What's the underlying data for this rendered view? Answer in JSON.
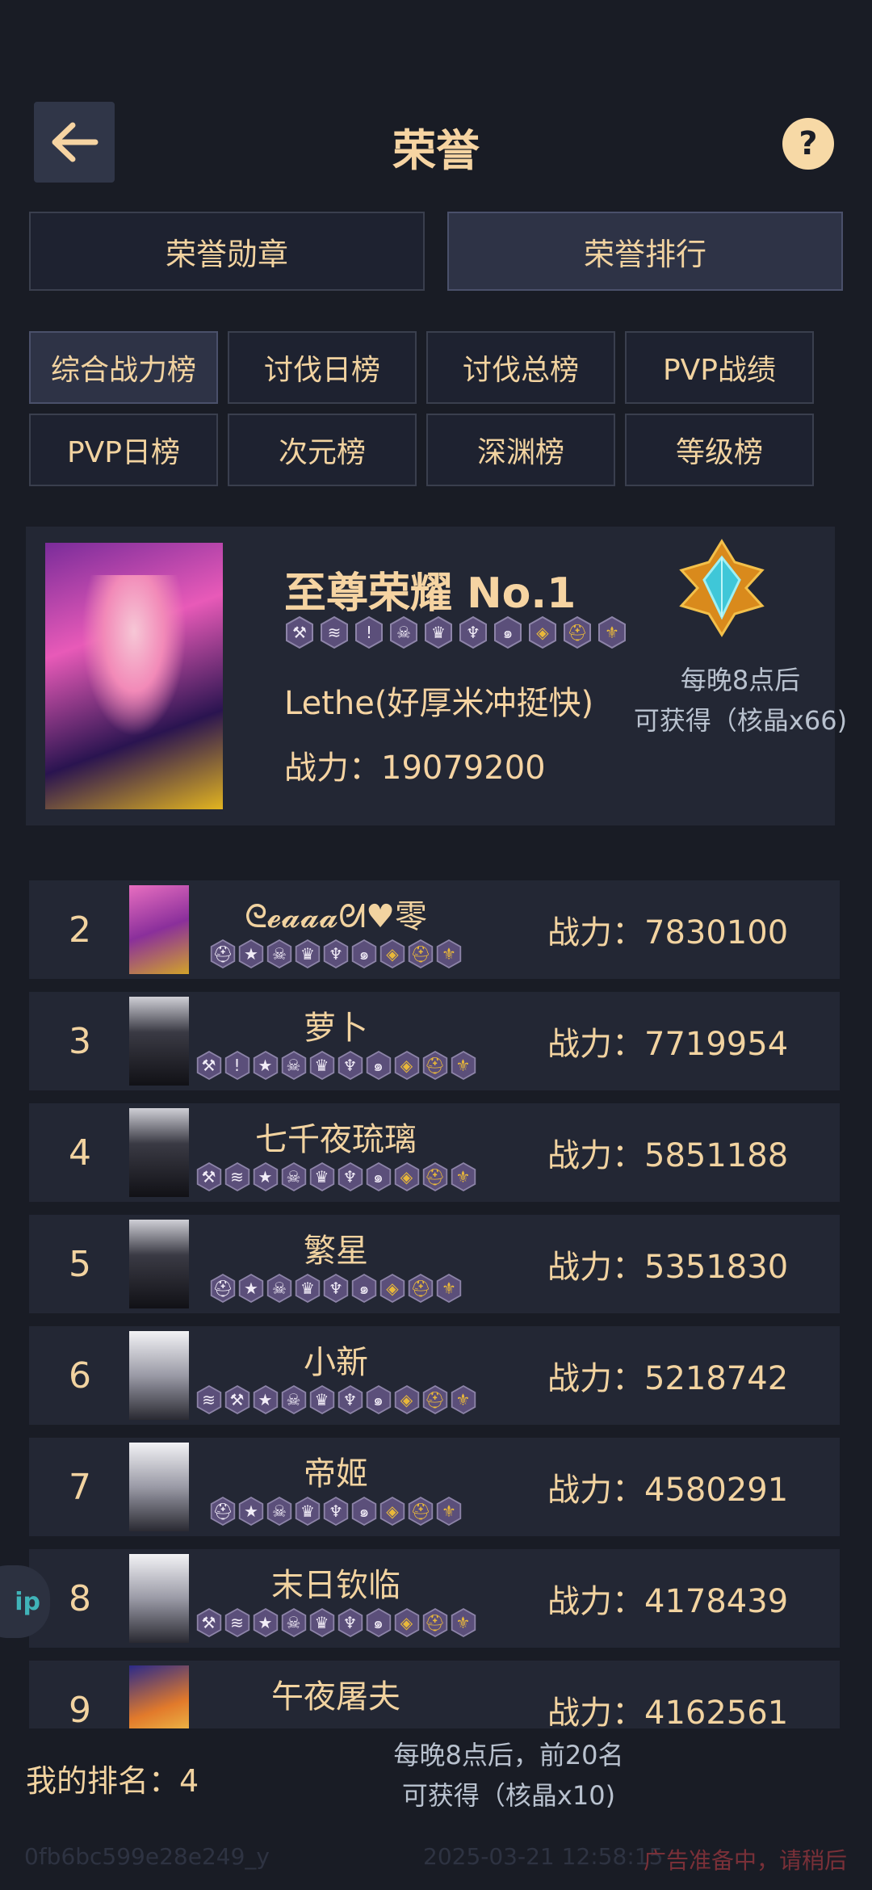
{
  "header": {
    "title": "荣誉",
    "back_icon": "arrow-left-icon",
    "help_label": "?"
  },
  "main_tabs": [
    {
      "label": "荣誉勋章",
      "active": false
    },
    {
      "label": "荣誉排行",
      "active": true
    }
  ],
  "sub_tabs": [
    {
      "label": "综合战力榜",
      "active": true
    },
    {
      "label": "讨伐日榜",
      "active": false
    },
    {
      "label": "讨伐总榜",
      "active": false
    },
    {
      "label": "PVP战绩",
      "active": false
    },
    {
      "label": "PVP日榜",
      "active": false
    },
    {
      "label": "次元榜",
      "active": false
    },
    {
      "label": "深渊榜",
      "active": false
    },
    {
      "label": "等级榜",
      "active": false
    }
  ],
  "top_player": {
    "title": "至尊荣耀 No.1",
    "name": "Lethe(好厚米冲挺快)",
    "power": "战力：19079200",
    "reward_line1": "每晚8点后",
    "reward_line2": "可获得（核晶x66)"
  },
  "ranking": [
    {
      "rank": "2",
      "name": "ᘓ𝓮𝓪𝓪𝓪ᘛ♥零",
      "power": "战力：7830100"
    },
    {
      "rank": "3",
      "name": "萝卜",
      "power": "战力：7719954"
    },
    {
      "rank": "4",
      "name": "七千夜琉璃",
      "power": "战力：5851188"
    },
    {
      "rank": "5",
      "name": "繁星",
      "power": "战力：5351830"
    },
    {
      "rank": "6",
      "name": "小新",
      "power": "战力：5218742"
    },
    {
      "rank": "7",
      "name": "帝姬",
      "power": "战力：4580291"
    },
    {
      "rank": "8",
      "name": "末日钦临",
      "power": "战力：4178439"
    },
    {
      "rank": "9",
      "name": "午夜屠夫",
      "power": "战力：4162561"
    }
  ],
  "bottom": {
    "my_rank": "我的排名：4",
    "reward_line1": "每晚8点后，前20名",
    "reward_line2": "可获得（核晶x10)",
    "float_label": "ip"
  },
  "footer": {
    "device_id": "0fb6bc599e28e249_y",
    "timestamp": "2025-03-21 12:58:15",
    "ad_status": "广告准备中，请稍后"
  },
  "colors": {
    "accent": "#f2d3a0",
    "background": "#191c25",
    "panel": "#232734",
    "badge": "#5b4f7a",
    "gold": "#e9b83a"
  }
}
